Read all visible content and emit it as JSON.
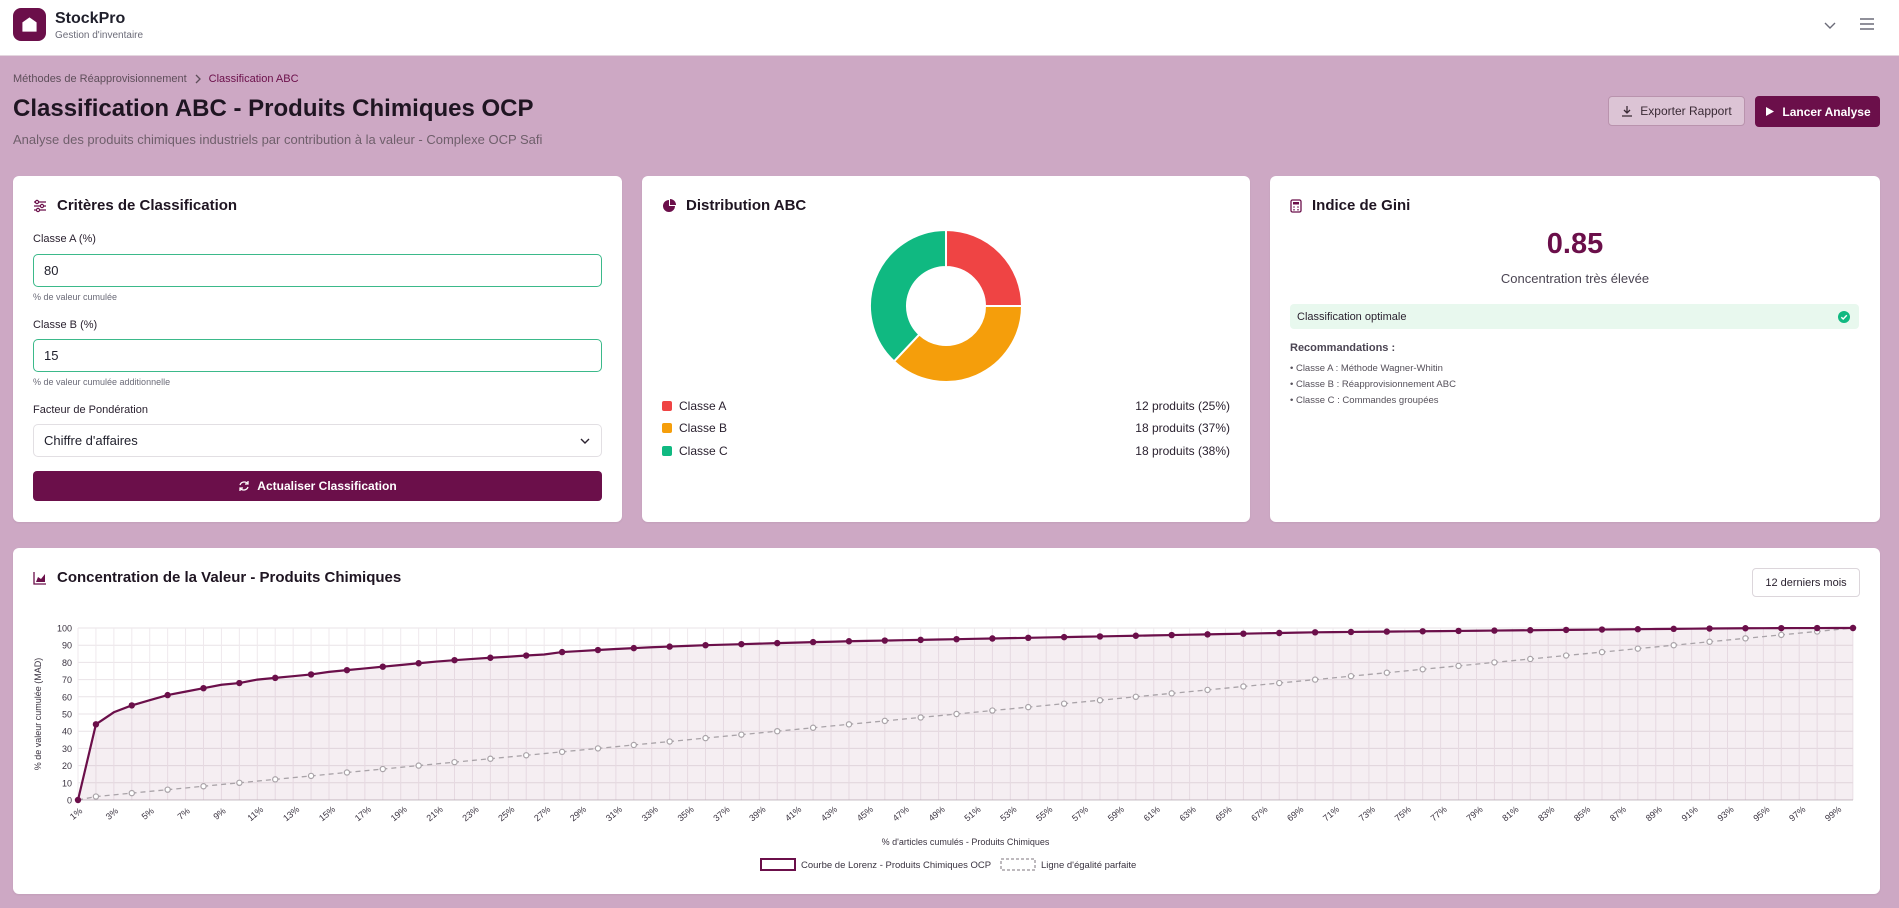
{
  "app": {
    "name": "StockPro",
    "subtitle": "Gestion d'inventaire"
  },
  "icons": {
    "logo": "home-icon",
    "topbar_chevron": "chevron-down-icon",
    "topbar_menu": "menu-icon",
    "breadcrumb_sep": "chevron-right-icon",
    "export": "download-icon",
    "launch": "play-icon",
    "criteria": "sliders-icon",
    "distribution": "pie-chart-icon",
    "gini": "calculator-icon",
    "refresh": "refresh-icon",
    "select": "chevron-down-icon",
    "status": "check-circle-icon",
    "concentration": "area-chart-icon"
  },
  "breadcrumb": {
    "parent": "Méthodes de Réapprovisionnement",
    "current": "Classification ABC"
  },
  "header": {
    "title": "Classification ABC - Produits Chimiques OCP",
    "subtitle": "Analyse des produits chimiques industriels par contribution à la valeur - Complexe OCP Safi",
    "export_label": "Exporter Rapport",
    "launch_label": "Lancer Analyse"
  },
  "criteria": {
    "title": "Critères de Classification",
    "class_a_label": "Classe A (%)",
    "class_a_value": "80",
    "class_a_help": "% de valeur cumulée",
    "class_b_label": "Classe B (%)",
    "class_b_value": "15",
    "class_b_help": "% de valeur cumulée additionnelle",
    "weighting_label": "Facteur de Pondération",
    "weighting_value": "Chiffre d'affaires",
    "refresh_label": "Actualiser Classification"
  },
  "distribution": {
    "title": "Distribution ABC",
    "classes": [
      {
        "label": "Classe A",
        "count": "12 produits (25%)",
        "percent": 25,
        "color": "#ef4444"
      },
      {
        "label": "Classe B",
        "count": "18 produits (37%)",
        "percent": 37,
        "color": "#f59e0b"
      },
      {
        "label": "Classe C",
        "count": "18 produits (38%)",
        "percent": 38,
        "color": "#10b981"
      }
    ]
  },
  "gini": {
    "title": "Indice de Gini",
    "value": "0.85",
    "label": "Concentration très élevée",
    "status": "Classification optimale",
    "reco_title": "Recommandations :",
    "recommendations": [
      "• Classe A : Méthode Wagner-Whitin",
      "• Classe B : Réapprovisionnement ABC",
      "• Classe C : Commandes groupées"
    ]
  },
  "concentration": {
    "title": "Concentration de la Valeur - Produits Chimiques",
    "period": "12 derniers mois"
  },
  "chart_data": {
    "type": "line",
    "title": "",
    "xlabel": "% d'articles cumulés - Produits Chimiques",
    "ylabel": "% de valeur cumulée (MAD)",
    "ylim": [
      0,
      100
    ],
    "yticks": [
      0,
      10,
      20,
      30,
      40,
      50,
      60,
      70,
      80,
      90,
      100
    ],
    "xtick_labels": [
      "1%",
      "3%",
      "5%",
      "7%",
      "9%",
      "11%",
      "13%",
      "15%",
      "17%",
      "19%",
      "21%",
      "23%",
      "25%",
      "27%",
      "29%",
      "31%",
      "33%",
      "35%",
      "37%",
      "39%",
      "41%",
      "43%",
      "45%",
      "47%",
      "49%",
      "51%",
      "53%",
      "55%",
      "57%",
      "59%",
      "61%",
      "63%",
      "65%",
      "67%",
      "69%",
      "71%",
      "73%",
      "75%",
      "77%",
      "79%",
      "81%",
      "83%",
      "85%",
      "87%",
      "89%",
      "91%",
      "93%",
      "95%",
      "97%",
      "99%"
    ],
    "grid": true,
    "legend": "bottom-center",
    "x": [
      1,
      2,
      3,
      4,
      5,
      6,
      7,
      8,
      9,
      10,
      11,
      12,
      13,
      14,
      15,
      16,
      17,
      18,
      19,
      20,
      21,
      22,
      23,
      24,
      25,
      26,
      27,
      28,
      29,
      30,
      31,
      32,
      33,
      34,
      35,
      36,
      37,
      38,
      39,
      40,
      41,
      42,
      43,
      44,
      45,
      46,
      47,
      48,
      49,
      50,
      51,
      52,
      53,
      54,
      55,
      56,
      57,
      58,
      59,
      60,
      61,
      62,
      63,
      64,
      65,
      66,
      67,
      68,
      69,
      70,
      71,
      72,
      73,
      74,
      75,
      76,
      77,
      78,
      79,
      80,
      81,
      82,
      83,
      84,
      85,
      86,
      87,
      88,
      89,
      90,
      91,
      92,
      93,
      94,
      95,
      96,
      97,
      98,
      99,
      100
    ],
    "series": [
      {
        "name": "Courbe de Lorenz - Produits Chimiques OCP",
        "color": "#6b0f4a",
        "values": [
          0,
          44,
          51,
          55,
          58,
          61,
          63,
          65,
          67,
          68,
          70,
          71,
          72,
          73,
          74.5,
          75.5,
          76.5,
          77.5,
          78.5,
          79.5,
          80.5,
          81.3,
          82,
          82.7,
          83.3,
          84,
          84.6,
          86,
          86.6,
          87.2,
          87.8,
          88.3,
          88.8,
          89.2,
          89.6,
          90,
          90.3,
          90.6,
          90.9,
          91.2,
          91.5,
          91.8,
          92,
          92.3,
          92.5,
          92.7,
          92.9,
          93.1,
          93.3,
          93.5,
          93.7,
          93.9,
          94.1,
          94.3,
          94.5,
          94.7,
          94.9,
          95.1,
          95.3,
          95.5,
          95.7,
          95.9,
          96.1,
          96.3,
          96.5,
          96.7,
          96.9,
          97.1,
          97.3,
          97.5,
          97.6,
          97.7,
          97.8,
          97.9,
          98,
          98.1,
          98.2,
          98.3,
          98.4,
          98.5,
          98.6,
          98.7,
          98.8,
          98.9,
          99,
          99.1,
          99.2,
          99.3,
          99.4,
          99.5,
          99.6,
          99.7,
          99.8,
          99.85,
          99.9,
          99.92,
          99.95,
          99.97,
          99.99,
          100
        ]
      },
      {
        "name": "Ligne d'égalité parfaite",
        "color": "#a9a3a8",
        "dashed": true,
        "values": [
          0,
          2,
          3,
          4,
          5,
          6,
          7,
          8,
          9,
          10,
          11,
          12,
          13,
          14,
          15,
          16,
          17,
          18,
          19,
          20,
          21,
          22,
          23,
          24,
          25,
          26,
          27,
          28,
          29,
          30,
          31,
          32,
          33,
          34,
          35,
          36,
          37,
          38,
          39,
          40,
          41,
          42,
          43,
          44,
          45,
          46,
          47,
          48,
          49,
          50,
          51,
          52,
          53,
          54,
          55,
          56,
          57,
          58,
          59,
          60,
          61,
          62,
          63,
          64,
          65,
          66,
          67,
          68,
          69,
          70,
          71,
          72,
          73,
          74,
          75,
          76,
          77,
          78,
          79,
          80,
          81,
          82,
          83,
          84,
          85,
          86,
          87,
          88,
          89,
          90,
          91,
          92,
          93,
          94,
          95,
          96,
          97,
          98,
          99,
          100
        ]
      }
    ]
  }
}
